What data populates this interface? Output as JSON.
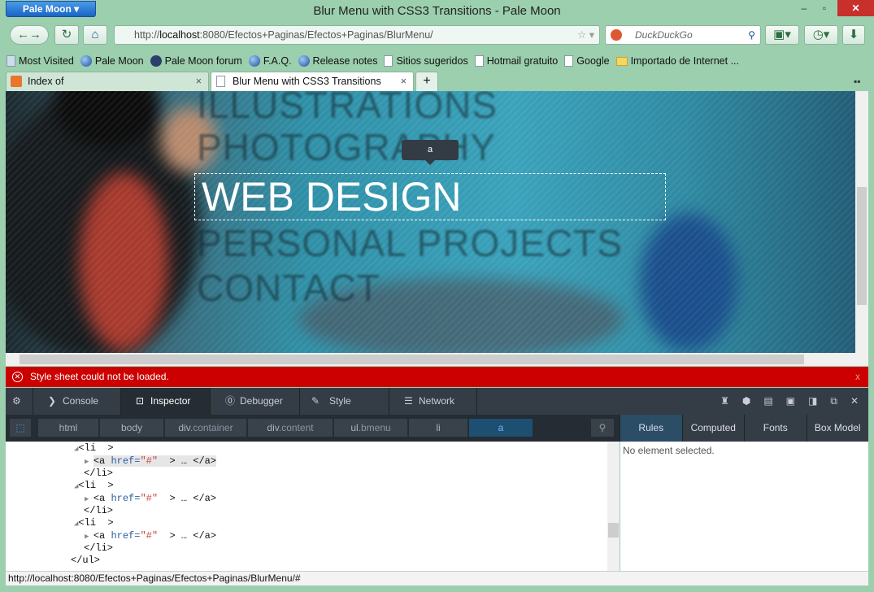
{
  "window": {
    "app_button": "Pale Moon",
    "title": "Blur Menu with CSS3 Transitions - Pale Moon"
  },
  "nav": {
    "url_prefix": "http://",
    "url_host": "localhost",
    "url_rest": ":8080/Efectos+Paginas/Efectos+Paginas/BlurMenu/",
    "search_placeholder": "DuckDuckGo"
  },
  "bookmarks": [
    {
      "label": "Most Visited",
      "icon": "search"
    },
    {
      "label": "Pale Moon",
      "icon": "globe"
    },
    {
      "label": "Pale Moon forum",
      "icon": "f-globe"
    },
    {
      "label": "F.A.Q.",
      "icon": "globe"
    },
    {
      "label": "Release notes",
      "icon": "globe"
    },
    {
      "label": "Sitios sugeridos",
      "icon": "page"
    },
    {
      "label": "Hotmail gratuito",
      "icon": "page"
    },
    {
      "label": "Google",
      "icon": "page"
    },
    {
      "label": "Importado de Internet ...",
      "icon": "folder"
    }
  ],
  "tabs": [
    {
      "label": "Index of /Efectos+Paginas/Efectos+P...",
      "active": false
    },
    {
      "label": "Blur Menu with CSS3 Transitions",
      "active": true
    }
  ],
  "page": {
    "menu": [
      "ILLUSTRATIONS",
      "PHOTOGRAPHY",
      "WEB DESIGN",
      "PERSONAL PROJECTS",
      "CONTACT"
    ],
    "tooltip": "a"
  },
  "error": {
    "message": "Style sheet could not be loaded.",
    "close": "x",
    "color": "#cc0000"
  },
  "devtools": {
    "tools": [
      "Console",
      "Inspector",
      "Debugger",
      "Style Editor",
      "Network"
    ],
    "breadcrumbs": [
      {
        "tag": "html",
        "cls": ""
      },
      {
        "tag": "body",
        "cls": ""
      },
      {
        "tag": "div",
        "cls": ".container"
      },
      {
        "tag": "div",
        "cls": ".content"
      },
      {
        "tag": "ul",
        "cls": ".bmenu"
      },
      {
        "tag": "li",
        "cls": ""
      },
      {
        "tag": "a",
        "cls": ""
      }
    ],
    "side_tabs": [
      "Rules",
      "Computed",
      "Fonts",
      "Box Model"
    ],
    "rules_empty": "No element selected.",
    "markup": {
      "li_open": "<li  >",
      "a_open": "<a ",
      "attr": "href=",
      "val": "\"#\"",
      "a_rest": "  > … </a>",
      "li_close": "</li>",
      "ul_close": "</ul>"
    }
  },
  "status": "http://localhost:8080/Efectos+Paginas/Efectos+Paginas/BlurMenu/#"
}
